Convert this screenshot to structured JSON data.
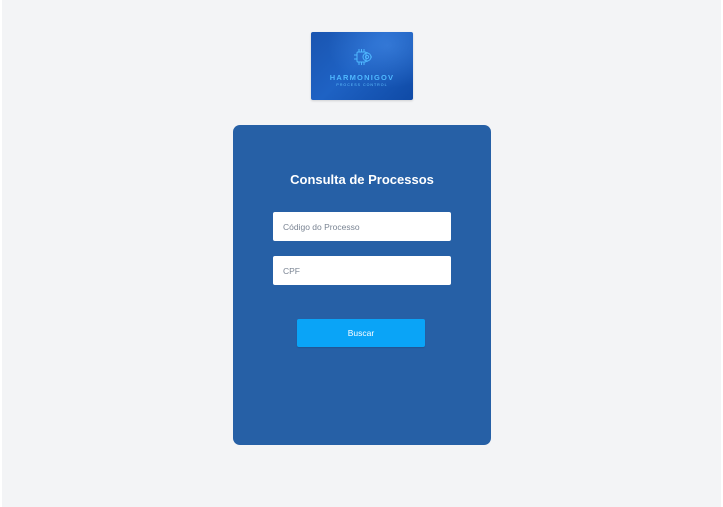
{
  "logo": {
    "name": "HARMONIGOV",
    "tagline": "PROCESS CONTROL",
    "icon": "gear-chip-icon",
    "background_color": "#1a55b0",
    "text_color": "#4fb8ff"
  },
  "form": {
    "title": "Consulta de Processos",
    "process_code": {
      "placeholder": "Código do Processo",
      "value": ""
    },
    "cpf": {
      "placeholder": "CPF",
      "value": ""
    },
    "search_label": "Buscar"
  },
  "colors": {
    "page_background": "#f3f4f6",
    "card_background": "#2660a6",
    "button_background": "#0aa4f7"
  }
}
